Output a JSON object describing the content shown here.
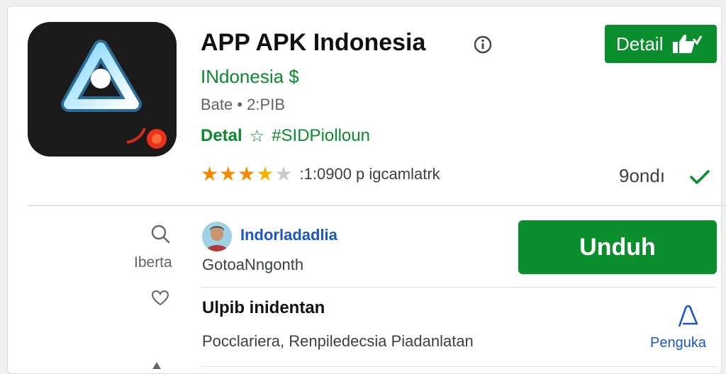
{
  "header": {
    "app_title": "APP APK Indonesia",
    "developer": "INdonesia $",
    "meta": "Bate • 2:PIB",
    "tag_label": "Detal",
    "hashtag": "#SIDPiolloun",
    "rating_text": ":1:0900 p igcamlatrk",
    "rating_stars": 3.5,
    "detail_button": "Detail",
    "size_label": "9ondı"
  },
  "sidebar": {
    "label": "Iberta"
  },
  "review": {
    "reviewer_name": "Indorladadlia",
    "reviewer_sub": "GotoaNngonth"
  },
  "actions": {
    "download_button": "Unduh",
    "report_label": "Penguka"
  },
  "section": {
    "title": "Ulpib inidentan",
    "body": "Pocclariera,  Renpiledecsia Piadanlatan"
  },
  "colors": {
    "accent_green": "#0b8f2e",
    "link_blue": "#1a56c8",
    "star_orange": "#f08a00"
  },
  "icons": [
    "info-icon",
    "thumbs-up-icon",
    "star-outline-icon",
    "check-icon",
    "search-icon",
    "heart-icon",
    "report-flag-icon",
    "arrow-icon"
  ]
}
